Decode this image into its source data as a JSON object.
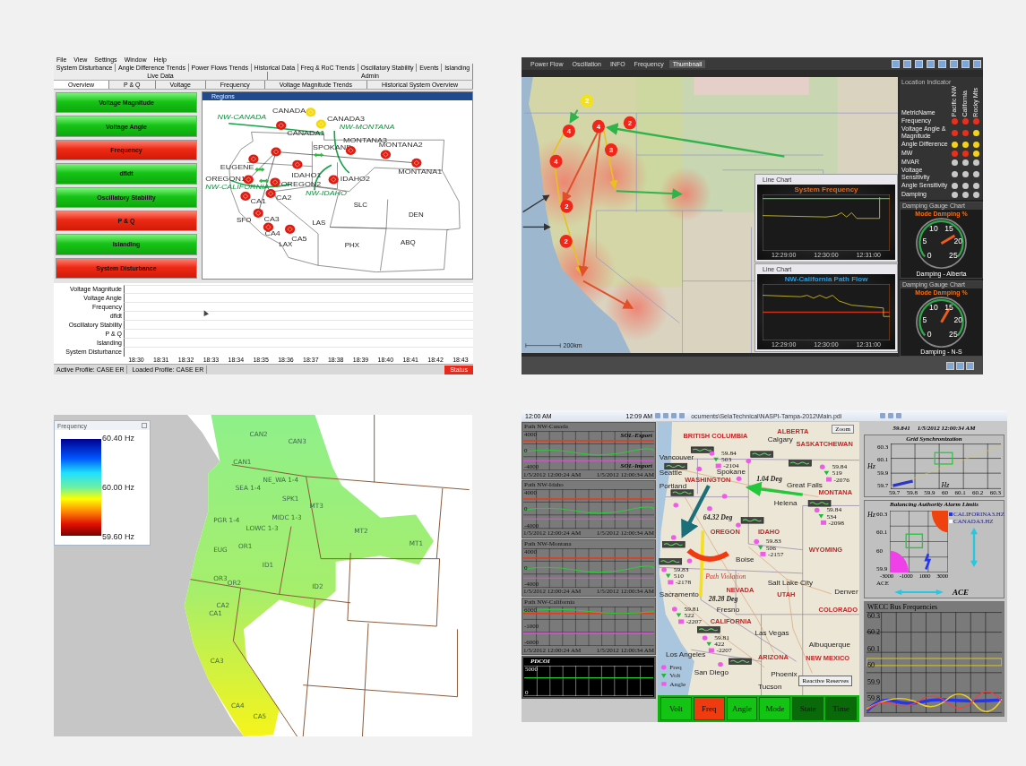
{
  "dashboard": {
    "menu": [
      "File",
      "View",
      "Settings",
      "Window",
      "Help"
    ],
    "tabs_top": [
      {
        "label": "System Disturbance",
        "selected": false
      },
      {
        "label": "Angle Difference Trends",
        "selected": false
      },
      {
        "label": "Power Flows Trends",
        "selected": false
      },
      {
        "label": "Historical Data",
        "selected": false
      },
      {
        "label": "Freq & RoC Trends",
        "selected": false
      },
      {
        "label": "Oscillatory Stability",
        "selected": false
      },
      {
        "label": "Events",
        "selected": false
      },
      {
        "label": "Islanding",
        "selected": false
      },
      {
        "label": "Live Data",
        "selected": false
      },
      {
        "label": "Admin",
        "selected": false
      }
    ],
    "tabs_bottom": [
      {
        "label": "Overview",
        "selected": true
      },
      {
        "label": "P & Q",
        "selected": false
      },
      {
        "label": "Voltage",
        "selected": false
      },
      {
        "label": "Frequency",
        "selected": false
      },
      {
        "label": "Voltage Magnitude Trends",
        "selected": false
      },
      {
        "label": "Historical System Overview",
        "selected": false
      }
    ],
    "indicators": [
      {
        "label": "Voltage Magnitude",
        "alarm": false
      },
      {
        "label": "Voltage Angle",
        "alarm": false
      },
      {
        "label": "Frequency",
        "alarm": true
      },
      {
        "label": "dfldt",
        "alarm": false
      },
      {
        "label": "Oscillatory Stability",
        "alarm": false
      },
      {
        "label": "P & Q",
        "alarm": true
      },
      {
        "label": "Islanding",
        "alarm": false
      },
      {
        "label": "System Disturbance",
        "alarm": true
      }
    ],
    "map": {
      "title": "Regions",
      "nodes": [
        {
          "name": "CANADA",
          "color": "#f5d90a"
        },
        {
          "name": "CANADA3",
          "color": "#f5d90a"
        },
        {
          "name": "CANADA1",
          "color": "#e01c10"
        },
        {
          "name": "SPOKANE"
        },
        {
          "name": "MONTANA3",
          "color": "#e01c10"
        },
        {
          "name": "MONTANA2",
          "color": "#e01c10"
        },
        {
          "name": "MONTANA1",
          "color": "#e01c10"
        },
        {
          "color": "#e01c10"
        },
        {
          "name": "EUGENE",
          "color": "#e01c10"
        },
        {
          "name": "IDAHO1",
          "color": "#e01c10"
        },
        {
          "name": "OREGON1",
          "color": "#e01c10"
        },
        {
          "name": "OREGON2",
          "color": "#e01c10"
        },
        {
          "name": "IDAHO2",
          "color": "#e01c10"
        },
        {
          "name": "CA1",
          "color": "#e01c10"
        },
        {
          "name": "CA2",
          "color": "#e01c10"
        },
        {
          "name": "CA3",
          "color": "#e01c10"
        },
        {
          "name": "CA4",
          "color": "#e01c10"
        },
        {
          "name": "CA5",
          "color": "#e01c10"
        }
      ],
      "paths": [
        "NW-CANADA",
        "NW-MONTANA",
        "NW-CALIFORNIA",
        "NW-IDAHO"
      ],
      "regions": [
        "SLC",
        "DEN",
        "LAS",
        "PHX",
        "ABQ",
        "SFO",
        "LAX"
      ]
    },
    "trend": {
      "rows": [
        "Voltage Magnitude",
        "Voltage Angle",
        "Frequency",
        "dfldt",
        "Oscillatory Stability",
        "P & Q",
        "Islanding",
        "System Disturbance"
      ],
      "times": [
        "18:30",
        "18:31",
        "18:32",
        "18:33",
        "18:34",
        "18:35",
        "18:36",
        "18:37",
        "18:38",
        "18:39",
        "18:40",
        "18:41",
        "18:42",
        "18:43"
      ]
    },
    "status_bar": {
      "active_profile": "Active Profile: CASE ER",
      "loaded_profile": "Loaded Profile: CASE ER",
      "status": "Status"
    }
  },
  "oscillation_monitor": {
    "tabs": [
      {
        "label": "Power Flow",
        "selected": false
      },
      {
        "label": "Oscillation",
        "selected": false
      },
      {
        "label": "INFO",
        "selected": false
      },
      {
        "label": "Frequency",
        "selected": false
      },
      {
        "label": "Thumbnail",
        "selected": true
      }
    ],
    "markers": [
      {
        "label": "2",
        "color": "#f3e21a"
      },
      {
        "label": "4",
        "color": "#f0261a"
      },
      {
        "label": "4",
        "color": "#f0261a"
      },
      {
        "label": "2",
        "color": "#f0261a"
      },
      {
        "label": "3",
        "color": "#f0261a"
      },
      {
        "label": "4",
        "color": "#f0261a"
      },
      {
        "label": "2",
        "color": "#f0261a"
      },
      {
        "label": "2",
        "color": "#f0261a"
      }
    ],
    "scale": "200km",
    "charts": [
      {
        "window_title": "Line Chart",
        "title": "System Frequency",
        "color": "#e0661a",
        "xticks": [
          "12:29:00",
          "12:30:00",
          "12:31:00"
        ]
      },
      {
        "window_title": "Line Chart",
        "title": "NW-California Path Flow",
        "color": "#2a9de0",
        "xticks": [
          "12:29:00",
          "12:30:00",
          "12:31:00"
        ]
      }
    ],
    "indicator_panel": {
      "title": "Location Indicator",
      "header": "MetricName",
      "columns": [
        "Pacific NW",
        "California",
        "Rocky Mts"
      ],
      "metrics": [
        {
          "name": "Frequency",
          "dots": [
            {
              "color": "#e8301c"
            },
            {
              "color": "#e8301c"
            },
            {
              "color": "#e8301c"
            }
          ]
        },
        {
          "name": "Voltage Angle & Magnitude",
          "dots": [
            {
              "color": "#e8301c"
            },
            {
              "color": "#e8301c"
            },
            {
              "color": "#f2d21c"
            }
          ]
        },
        {
          "name": "Angle Difference",
          "dots": [
            {
              "color": "#f2d21c"
            },
            {
              "color": "#f2d21c"
            },
            {
              "color": "#f2d21c"
            }
          ]
        },
        {
          "name": "MW",
          "dots": [
            {
              "color": "#e8301c"
            },
            {
              "color": "#e8301c"
            },
            {
              "color": "#f2d21c"
            }
          ]
        },
        {
          "name": "MVAR",
          "dots": [
            {
              "color": "#c8c8c8"
            },
            {
              "color": "#c8c8c8"
            },
            {
              "color": "#c8c8c8"
            }
          ]
        },
        {
          "name": "Voltage Sensitivity",
          "dots": [
            {
              "color": "#c8c8c8"
            },
            {
              "color": "#c8c8c8"
            },
            {
              "color": "#c8c8c8"
            }
          ]
        },
        {
          "name": "Angle Sensitivity",
          "dots": [
            {
              "color": "#c8c8c8"
            },
            {
              "color": "#c8c8c8"
            },
            {
              "color": "#c8c8c8"
            }
          ]
        },
        {
          "name": "Damping",
          "dots": [
            {
              "color": "#c8c8c8"
            },
            {
              "color": "#c8c8c8"
            },
            {
              "color": "#c8c8c8"
            }
          ]
        }
      ]
    },
    "gauges": [
      {
        "window_title": "Damping Gauge Chart",
        "title": "Mode Damping %",
        "ticks": [
          "0",
          "5",
          "10",
          "15",
          "20",
          "25"
        ],
        "caption": "Damping - Alberta"
      },
      {
        "window_title": "Damping Gauge Chart",
        "title": "Mode Damping %",
        "ticks": [
          "0",
          "5",
          "10",
          "15",
          "20",
          "25"
        ],
        "caption": "Damping - N-S"
      }
    ]
  },
  "frequency_map": {
    "legend": {
      "title": "Frequency",
      "labels": [
        "60.40 Hz",
        "60.00 Hz",
        "59.60 Hz"
      ]
    },
    "stations": [
      "CAN2",
      "CAN3",
      "CAN1",
      "NE_WA 1-4",
      "SEA 1-4",
      "SPK1",
      "MT3",
      "MIDC 1-3",
      "PGR 1-4",
      "LOWC 1-3",
      "MT2",
      "MT1",
      "EUG",
      "OR1",
      "ID1",
      "OR3",
      "OR2",
      "ID2",
      "CA2",
      "CA1",
      "CA3",
      "CA4",
      "CA5"
    ]
  },
  "wide_area_display": {
    "toolbar": {
      "time_left": "12:00 AM",
      "time_right": "12:09 AM",
      "path": "ocuments\\SelaTechnical\\NASPI-Tampa-2012\\Main.pdi"
    },
    "paths": [
      {
        "title": "Path NW-Canada",
        "ticks": [
          "4000",
          "0",
          "-4000"
        ],
        "export": "SOL-Export",
        "import": "SOL-Import",
        "start": "1/5/2012 12:00:24 AM",
        "end": "1/5/2012 12:00:34 AM"
      },
      {
        "title": "Path NW-Idaho",
        "ticks": [
          "4000",
          "0",
          "-4000"
        ],
        "start": "1/5/2012 12:00:24 AM",
        "end": "1/5/2012 12:00:34 AM"
      },
      {
        "title": "Path NW-Montana",
        "ticks": [
          "4000",
          "0",
          "-4000"
        ],
        "start": "1/5/2012 12:00:24 AM",
        "end": "1/5/2012 12:00:34 AM"
      },
      {
        "title": "Path NW-California",
        "ticks": [
          "6000",
          "-1000",
          "-6000"
        ],
        "start": "1/5/2012 12:00:24 AM",
        "end": "1/5/2012 12:00:34 AM"
      }
    ],
    "pdci": {
      "title": "PDCOI",
      "ticks": [
        "5000",
        "0"
      ]
    },
    "map": {
      "zoom": "Zoom",
      "states": [
        "ALBERTA",
        "BRITISH COLUMBIA",
        "SASKATCHEWAN",
        "WASHINGTON",
        "MONTANA",
        "OREGON",
        "IDAHO",
        "WYOMING",
        "NEVADA",
        "UTAH",
        "COLORADO",
        "CALIFORNIA",
        "ARIZONA",
        "NEW MEXICO"
      ],
      "cities": [
        "Calgary",
        "Vancouver",
        "Seattle",
        "Spokane",
        "Portland",
        "Great Falls",
        "Helena",
        "Boise",
        "Salt Lake City",
        "Sacramento",
        "Denver",
        "Fresno",
        "Las Vegas",
        "Albuquerque",
        "Los Angeles",
        "San Diego",
        "Phoenix",
        "Tucson"
      ],
      "readings": [
        {
          "freq": "59.84",
          "volt": "503",
          "angle": "-2104"
        },
        {
          "freq": "59.84",
          "volt": "519",
          "angle": "-2076"
        },
        {
          "freq": "59.84",
          "volt": "534",
          "angle": "-2098"
        },
        {
          "freq": "59.83",
          "volt": "506",
          "angle": "-2157"
        },
        {
          "freq": "59.83",
          "volt": "510",
          "angle": "-2178"
        },
        {
          "freq": "59.81",
          "volt": "522",
          "angle": "-2207"
        },
        {
          "freq": "59.81",
          "volt": "422",
          "angle": "-2207"
        }
      ],
      "angles": [
        "1.04 Deg",
        "64.32 Deg",
        "28.28 Deg"
      ],
      "violation": "Path Violation",
      "legend": [
        "Freq",
        "Volt",
        "Angle"
      ],
      "reserves": "Reactive Reserves"
    },
    "buttons": [
      {
        "label": "Volt",
        "alarm": false,
        "disabled": false
      },
      {
        "label": "Freq",
        "alarm": true,
        "disabled": false
      },
      {
        "label": "Angle",
        "alarm": false,
        "disabled": false
      },
      {
        "label": "Mode",
        "alarm": false,
        "disabled": false
      },
      {
        "label": "State",
        "alarm": false,
        "disabled": true
      },
      {
        "label": "Time",
        "alarm": false,
        "disabled": true
      }
    ],
    "summary": {
      "frequency": "59.841",
      "timestamp": "1/5/2012 12:00:34 AM"
    },
    "grid_sync": {
      "title": "Grid Synchronization",
      "axis": "Hz",
      "yticks": [
        "60.3",
        "60.1",
        "59.9",
        "59.7"
      ],
      "xticks": [
        "59.7",
        "59.8",
        "59.9",
        "60",
        "60.1",
        "60.2",
        "60.3"
      ],
      "xlabel": "Hz"
    },
    "alarm_limits": {
      "title": "Balancing Authority Alarm Limits",
      "legend": [
        {
          "label": "CALIFORINA3.HZ",
          "color": "#2436f0"
        },
        {
          "label": "CANADA3.HZ",
          "color": "#ffffff"
        }
      ],
      "axis": "Hz",
      "yticks": [
        "60.3",
        "60.1",
        "60",
        "59.9"
      ],
      "xticks": [
        "-3000",
        "-1000",
        "1000",
        "3000"
      ],
      "xlabel": "ACE",
      "big_label": "ACE"
    },
    "bus_freq": {
      "title": "WECC Bus Frequencies",
      "yticks": [
        "60.3",
        "60.2",
        "60.1",
        "60",
        "59.9",
        "59.8"
      ]
    }
  }
}
